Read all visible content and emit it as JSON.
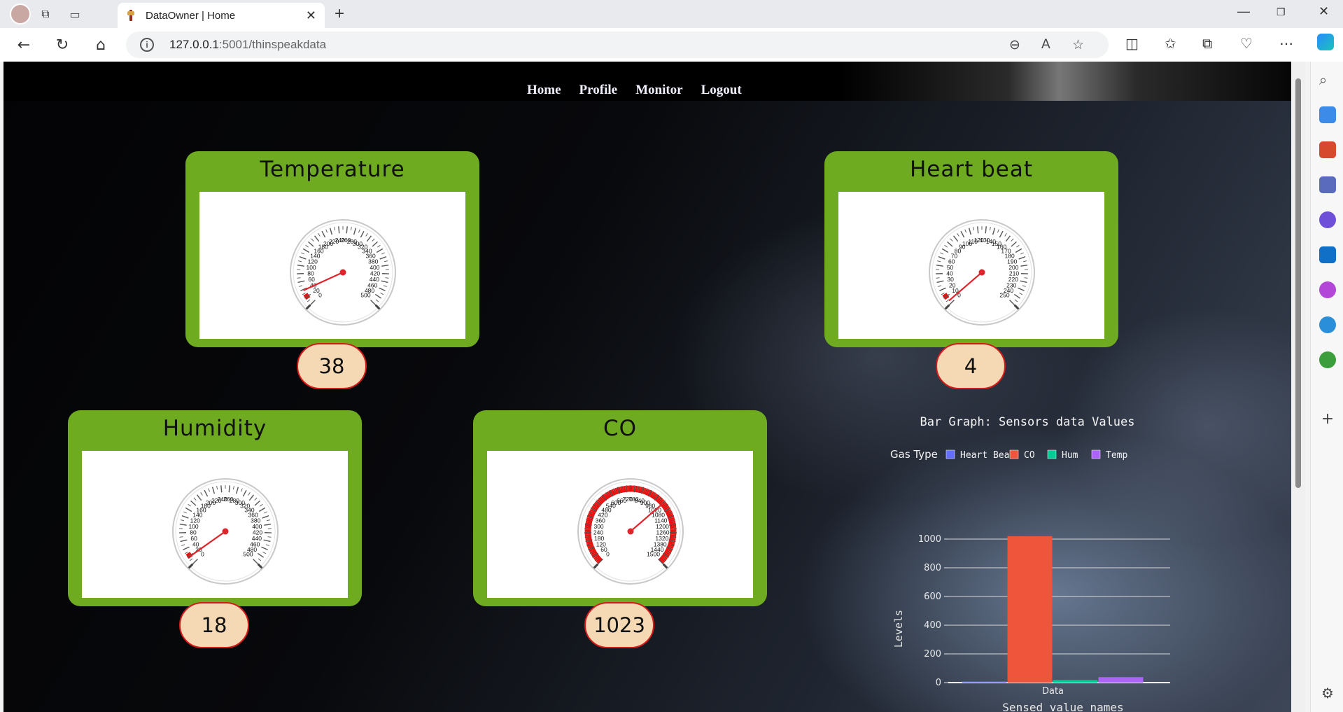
{
  "browser": {
    "tab_title": "DataOwner | Home",
    "url_host": "127.0.0.1",
    "url_rest": ":5001/thinspeakdata"
  },
  "nav": {
    "home": "Home",
    "profile": "Profile",
    "monitor": "Monitor",
    "logout": "Logout"
  },
  "gauges": [
    {
      "id": "temperature",
      "title": "Temperature",
      "value": "38",
      "num": 38,
      "min": 0,
      "max": 500,
      "step": 20,
      "red_from": 0,
      "red_to": 0,
      "ring": false
    },
    {
      "id": "heartbeat",
      "title": "Heart beat",
      "value": "4",
      "num": 4,
      "min": 0,
      "max": 250,
      "step": 10,
      "red_from": 0,
      "red_to": 0,
      "ring": false
    },
    {
      "id": "humidity",
      "title": "Humidity",
      "value": "18",
      "num": 18,
      "min": 0,
      "max": 500,
      "step": 20,
      "red_from": 0,
      "red_to": 0,
      "ring": false
    },
    {
      "id": "co",
      "title": "CO",
      "value": "1023",
      "num": 1023,
      "min": 0,
      "max": 1500,
      "step": 60,
      "red_from": 0,
      "red_to": 1500,
      "ring": true
    }
  ],
  "chart_data": {
    "type": "bar",
    "title": "Bar Graph: Sensors data Values",
    "legend_title": "Gas Type",
    "legend_position": "top",
    "xlabel": "Sensed value names",
    "ylabel": "Levels",
    "categories": [
      "Data"
    ],
    "series": [
      {
        "name": "Heart Beat",
        "values": [
          4
        ],
        "color": "#636efa"
      },
      {
        "name": "CO",
        "values": [
          1023
        ],
        "color": "#ef553b"
      },
      {
        "name": "Hum",
        "values": [
          18
        ],
        "color": "#00cc96"
      },
      {
        "name": "Temp",
        "values": [
          38
        ],
        "color": "#ab63fa"
      }
    ],
    "ylim": [
      0,
      1000
    ],
    "yticks": [
      0,
      200,
      400,
      600,
      800,
      1000
    ],
    "grid": true
  }
}
